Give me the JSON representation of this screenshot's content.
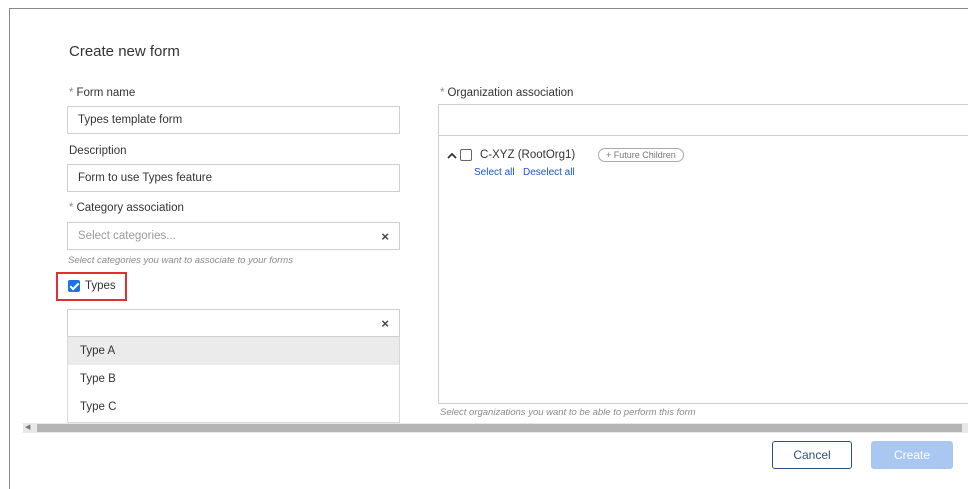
{
  "dialog": {
    "title": "Create new form"
  },
  "form_name": {
    "label": "Form name",
    "value": "Types template form"
  },
  "description": {
    "label": "Description",
    "value": "Form to use Types feature"
  },
  "category": {
    "label": "Category association",
    "placeholder": "Select categories...",
    "hint": "Select categories you want to associate to your forms"
  },
  "types": {
    "checkbox_label": "Types",
    "checked": true,
    "input_value": "",
    "options": [
      "Type A",
      "Type B",
      "Type C"
    ],
    "highlighted": "Type A"
  },
  "organization": {
    "label": "Organization association",
    "search_value": "",
    "tree": {
      "node_label": "C-XYZ (RootOrg1)",
      "future_children_label": "+ Future Children",
      "select_all": "Select all",
      "deselect_all": "Deselect all"
    },
    "hint": "Select organizations you want to be able to perform this form"
  },
  "buttons": {
    "cancel": "Cancel",
    "create": "Create"
  },
  "icons": {
    "required": "asterisk",
    "clear": "close-icon",
    "expand": "chevron-up-icon",
    "scroll_left": "scroll-left-arrow-icon"
  },
  "colors": {
    "accent": "#1a73e8",
    "highlight_border": "#e03131",
    "cancel_border": "#2c4f86",
    "create_disabled": "#a9c7f0",
    "link": "#1a55c9"
  }
}
